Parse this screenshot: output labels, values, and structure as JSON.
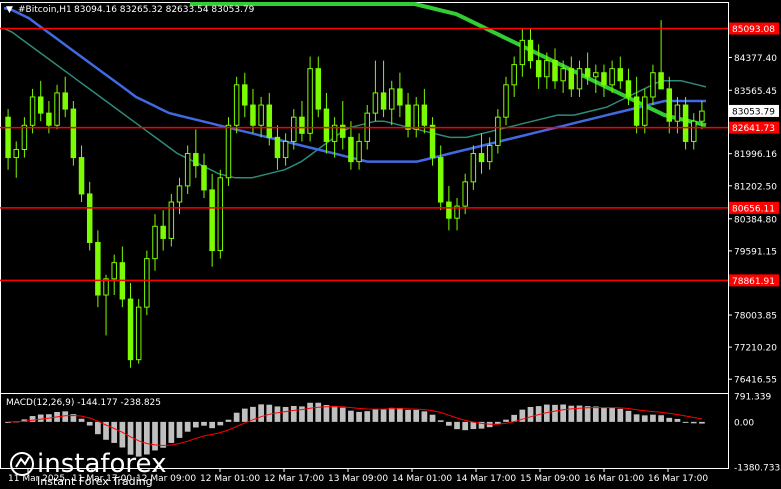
{
  "header": {
    "symbol": "#Bitcoin,H1",
    "ohlc": "83094.16 83265.32 82633.54 83053.79"
  },
  "macd": {
    "label": "MACD(12,26,9) -144.177 -238.825"
  },
  "levels": {
    "red": [
      {
        "price": 85093.08,
        "label": "85093.08"
      },
      {
        "price": 82641.73,
        "label": "82641.73"
      },
      {
        "price": 80656.11,
        "label": "80656.11"
      },
      {
        "price": 78861.91,
        "label": "78861.91"
      }
    ],
    "current": {
      "price": 83053.79,
      "label": "83053.79"
    }
  },
  "axis": {
    "price_ticks": [
      "84377.40",
      "83565.45",
      "81996.16",
      "81202.50",
      "80384.80",
      "79591.15",
      "78003.85",
      "77210.20",
      "76416.55"
    ],
    "macd_ticks": [
      "791.339",
      "0.00",
      "-1380.733"
    ],
    "time_ticks": [
      "11 Mar 2025",
      "11 Mar 17:00",
      "12 Mar 09:00",
      "12 Mar 01:00",
      "12 Mar 17:00",
      "13 Mar 09:00",
      "14 Mar 01:00",
      "14 Mar 17:00",
      "15 Mar 09:00",
      "16 Mar 01:00",
      "16 Mar 17:00"
    ]
  },
  "brand": {
    "name": "instaforex",
    "tagline": "Instant Forex Trading"
  },
  "colors": {
    "background": "#000000",
    "bull": "#7CFC00",
    "bear": "#7CFC00",
    "ma_fast": "#2E8B7A",
    "ma_mid": "#4169E1",
    "ma_slow": "#32CD32",
    "level": "#FF0000",
    "macd_hist": "#C0C0C0",
    "macd_signal": "#FF0000"
  },
  "chart_data": {
    "type": "candlestick",
    "timeframe": "H1",
    "ylim": [
      76100,
      85700
    ],
    "candles": [
      [
        82900,
        83100,
        81600,
        81900
      ],
      [
        81900,
        82300,
        81400,
        82100
      ],
      [
        82100,
        82900,
        81900,
        82700
      ],
      [
        82700,
        83600,
        82500,
        83400
      ],
      [
        83400,
        83800,
        82800,
        83000
      ],
      [
        83000,
        83300,
        82500,
        82700
      ],
      [
        82700,
        83700,
        82600,
        83500
      ],
      [
        83500,
        83900,
        82900,
        83100
      ],
      [
        83100,
        83300,
        81700,
        81900
      ],
      [
        81900,
        82200,
        80800,
        81000
      ],
      [
        81000,
        81300,
        79600,
        79800
      ],
      [
        79800,
        80100,
        78200,
        78500
      ],
      [
        78500,
        79000,
        77500,
        78900
      ],
      [
        78900,
        79500,
        78500,
        79300
      ],
      [
        79300,
        79700,
        78200,
        78400
      ],
      [
        78400,
        78800,
        76700,
        76900
      ],
      [
        76900,
        78400,
        76800,
        78200
      ],
      [
        78200,
        79600,
        78000,
        79400
      ],
      [
        79400,
        80500,
        79100,
        80200
      ],
      [
        80200,
        80600,
        79600,
        79900
      ],
      [
        79900,
        81000,
        79700,
        80800
      ],
      [
        80800,
        81400,
        80500,
        81200
      ],
      [
        81200,
        82200,
        81000,
        82000
      ],
      [
        82000,
        82600,
        81400,
        81700
      ],
      [
        81700,
        82000,
        80900,
        81100
      ],
      [
        81100,
        81500,
        79200,
        79600
      ],
      [
        79600,
        81600,
        79400,
        81400
      ],
      [
        81400,
        82900,
        81200,
        82700
      ],
      [
        82700,
        83900,
        82500,
        83700
      ],
      [
        83700,
        84000,
        82900,
        83200
      ],
      [
        83200,
        83600,
        82500,
        82700
      ],
      [
        82700,
        83400,
        82400,
        83200
      ],
      [
        83200,
        83500,
        82200,
        82400
      ],
      [
        82400,
        82700,
        81600,
        81900
      ],
      [
        81900,
        82500,
        81700,
        82300
      ],
      [
        82300,
        83100,
        82100,
        82900
      ],
      [
        82900,
        83300,
        82300,
        82500
      ],
      [
        82500,
        84400,
        82300,
        84100
      ],
      [
        84100,
        84400,
        82900,
        83100
      ],
      [
        83100,
        83500,
        82000,
        82300
      ],
      [
        82300,
        82900,
        81900,
        82700
      ],
      [
        82700,
        83300,
        82100,
        82400
      ],
      [
        82400,
        82800,
        81600,
        81800
      ],
      [
        81800,
        82500,
        81600,
        82300
      ],
      [
        82300,
        83200,
        82100,
        83000
      ],
      [
        83000,
        84300,
        82800,
        83500
      ],
      [
        83500,
        84300,
        82900,
        83100
      ],
      [
        83100,
        83800,
        82700,
        83600
      ],
      [
        83600,
        84000,
        82900,
        83200
      ],
      [
        83200,
        83500,
        82400,
        82600
      ],
      [
        82600,
        83400,
        82400,
        83200
      ],
      [
        83200,
        83600,
        82500,
        82700
      ],
      [
        82700,
        82900,
        81700,
        81900
      ],
      [
        81900,
        82200,
        80600,
        80800
      ],
      [
        80800,
        81200,
        80100,
        80400
      ],
      [
        80400,
        80900,
        80100,
        80700
      ],
      [
        80700,
        81500,
        80500,
        81300
      ],
      [
        81300,
        82200,
        81100,
        82000
      ],
      [
        82000,
        82500,
        81500,
        81800
      ],
      [
        81800,
        82400,
        81600,
        82200
      ],
      [
        82200,
        83100,
        82000,
        82900
      ],
      [
        82900,
        83900,
        82700,
        83700
      ],
      [
        83700,
        84400,
        83400,
        84200
      ],
      [
        84200,
        85100,
        83900,
        84800
      ],
      [
        84800,
        85100,
        84100,
        84300
      ],
      [
        84300,
        84700,
        83600,
        83900
      ],
      [
        83900,
        84500,
        83600,
        84300
      ],
      [
        84300,
        84600,
        83600,
        83800
      ],
      [
        83800,
        84300,
        83500,
        84100
      ],
      [
        84100,
        84400,
        83400,
        83600
      ],
      [
        83600,
        84300,
        83400,
        84100
      ],
      [
        84100,
        84500,
        83700,
        83900
      ],
      [
        83900,
        84200,
        83500,
        84000
      ],
      [
        84000,
        84200,
        83400,
        83700
      ],
      [
        83700,
        84300,
        83500,
        84100
      ],
      [
        84100,
        84400,
        83600,
        83800
      ],
      [
        83800,
        84100,
        83200,
        83400
      ],
      [
        83400,
        83900,
        82500,
        82700
      ],
      [
        82700,
        83600,
        82500,
        83400
      ],
      [
        83400,
        84200,
        83200,
        84000
      ],
      [
        84000,
        85300,
        83700,
        83600
      ],
      [
        83600,
        83900,
        82500,
        82800
      ],
      [
        82800,
        83400,
        82500,
        83200
      ],
      [
        83200,
        83400,
        82100,
        82300
      ],
      [
        82300,
        83000,
        82100,
        82800
      ],
      [
        82800,
        83300,
        82600,
        83050
      ]
    ],
    "ma_fast": [
      85100,
      85000,
      84850,
      84700,
      84550,
      84400,
      84250,
      84100,
      83950,
      83800,
      83650,
      83500,
      83350,
      83200,
      83050,
      82900,
      82750,
      82600,
      82450,
      82300,
      82150,
      82000,
      81900,
      81800,
      81700,
      81600,
      81500,
      81450,
      81400,
      81400,
      81400,
      81450,
      81500,
      81550,
      81600,
      81700,
      81800,
      81950,
      82100,
      82250,
      82400,
      82550,
      82650,
      82700,
      82750,
      82800,
      82800,
      82750,
      82700,
      82650,
      82600,
      82550,
      82500,
      82450,
      82400,
      82400,
      82400,
      82450,
      82500,
      82550,
      82600,
      82650,
      82700,
      82750,
      82800,
      82850,
      82900,
      82950,
      82950,
      82950,
      83000,
      83050,
      83100,
      83150,
      83250,
      83350,
      83450,
      83550,
      83650,
      83750,
      83800,
      83800,
      83800,
      83750,
      83700,
      83650
    ],
    "ma_mid": [
      85600,
      85550,
      85450,
      85350,
      85200,
      85050,
      84900,
      84750,
      84600,
      84450,
      84300,
      84150,
      84000,
      83850,
      83700,
      83550,
      83400,
      83300,
      83200,
      83100,
      83000,
      82950,
      82900,
      82850,
      82800,
      82750,
      82700,
      82650,
      82600,
      82550,
      82500,
      82450,
      82400,
      82350,
      82300,
      82250,
      82200,
      82150,
      82100,
      82050,
      82000,
      81950,
      81900,
      81850,
      81800,
      81800,
      81800,
      81800,
      81800,
      81800,
      81800,
      81850,
      81900,
      81950,
      82000,
      82050,
      82100,
      82150,
      82200,
      82250,
      82300,
      82350,
      82400,
      82450,
      82500,
      82550,
      82600,
      82650,
      82700,
      82750,
      82800,
      82850,
      82900,
      82950,
      83000,
      83050,
      83100,
      83150,
      83200,
      83250,
      83300,
      83300,
      83300,
      83300,
      83300,
      83300
    ],
    "ma_slow": [
      85700,
      85700,
      85700,
      85700,
      85700,
      85700,
      85700,
      85700,
      85700,
      85700,
      85700,
      85700,
      85700,
      85700,
      85700,
      85700,
      85700,
      85700,
      85700,
      85700,
      85700,
      85700,
      85700,
      85700,
      85700,
      85700,
      85700,
      85700,
      85650,
      85600,
      85550,
      85500,
      85450,
      85350,
      85250,
      85150,
      85050,
      84950,
      84850,
      84750,
      84650,
      84550,
      84450,
      84350,
      84250,
      84150,
      84050,
      83950,
      83850,
      83750,
      83650,
      83550,
      83450,
      83350,
      83250,
      83150,
      83050,
      82950,
      82900,
      82850,
      82800,
      82750,
      82700
    ]
  }
}
